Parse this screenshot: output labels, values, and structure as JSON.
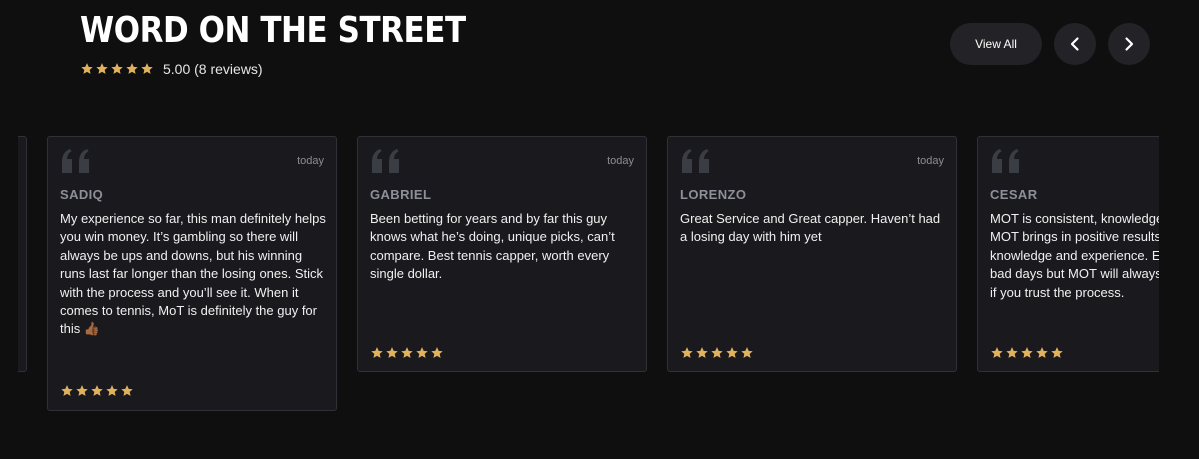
{
  "header": {
    "title": "WORD ON THE STREET",
    "rating_text": "5.00 (8 reviews)",
    "rating_stars": 5,
    "view_all_label": "View All"
  },
  "colors": {
    "background": "#0f0f10",
    "card": "#1a1a1e",
    "star": "#e0b25e",
    "quote_icon": "#3a3d44",
    "name": "#8d8f99"
  },
  "reviews": [
    {
      "name": "SADIQ",
      "date": "today",
      "text": "My experience so far, this man definitely helps you win money. It’s gambling so there will always be ups and downs, but his winning runs last far longer than the losing ones. Stick with the process and you’ll see it. When it comes to tennis, MoT is definitely the guy for this 👍🏾",
      "stars": 5
    },
    {
      "name": "GABRIEL",
      "date": "today",
      "text": "Been betting for years and by far this guy knows what he’s doing, unique picks, can’t compare. Best tennis capper, worth every single dollar.",
      "stars": 5
    },
    {
      "name": "LORENZO",
      "date": "today",
      "text": "Great Service and Great capper. Haven’t had a losing day with him yet",
      "stars": 5
    },
    {
      "name": "CESAR",
      "date": "",
      "text": "MOT is consistent, knowledgeable and active. MOT brings in positive results with his great knowledge and experience. Every person has bad days but MOT will always bring you back if you trust the process.",
      "stars": 5
    }
  ]
}
